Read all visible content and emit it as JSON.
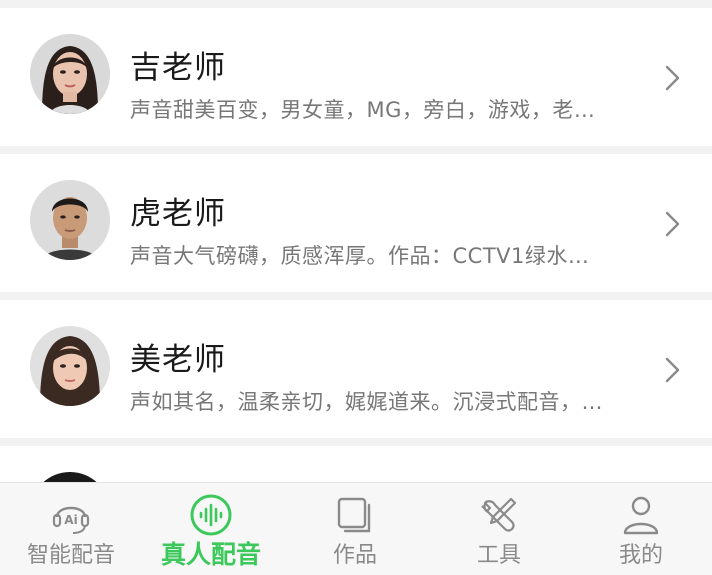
{
  "teachers": [
    {
      "name": "吉老师",
      "desc": "声音甜美百变，男女童，MG，旁白，游戏，老…",
      "avatar": "female-avatar"
    },
    {
      "name": "虎老师",
      "desc": "声音大气磅礴，质感浑厚。作品：CCTV1绿水…",
      "avatar": "male-avatar"
    },
    {
      "name": "美老师",
      "desc": "声如其名，温柔亲切，娓娓道来。沉浸式配音，…",
      "avatar": "female-avatar"
    }
  ],
  "tabs": [
    {
      "label": "智能配音",
      "icon": "ai-headset-icon",
      "active": false
    },
    {
      "label": "真人配音",
      "icon": "voice-wave-icon",
      "active": true
    },
    {
      "label": "作品",
      "icon": "works-icon",
      "active": false
    },
    {
      "label": "工具",
      "icon": "tools-icon",
      "active": false
    },
    {
      "label": "我的",
      "icon": "profile-icon",
      "active": false
    }
  ],
  "colors": {
    "accent": "#3dc85c",
    "inactive": "#8a8a8a",
    "background": "#f2f2f2"
  }
}
